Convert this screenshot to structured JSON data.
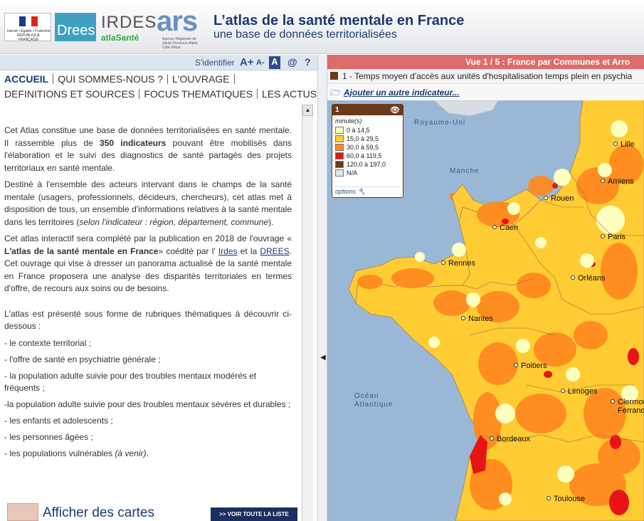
{
  "header": {
    "logos": {
      "republique": "Liberté • Égalité • Fraternité RÉPUBLIQUE FRANÇAISE",
      "drees": "Drees",
      "irdes": "IRDES",
      "atlassante": "atlaSanté",
      "ars": "ars",
      "ars_sub": "Agence Régionale de Santé Provence-Alpes Côte d'Azur"
    },
    "title": "L’atlas de la santé mentale en France",
    "subtitle": "une base de données territorialisées"
  },
  "toolbar": {
    "identify": "S'identifier",
    "font_up": "A+",
    "font_down": "A-",
    "font_default": "A",
    "contact": "@",
    "help": "?"
  },
  "nav": {
    "row1": [
      "ACCUEIL",
      "QUI SOMMES-NOUS ?",
      "L'OUVRAGE"
    ],
    "row2": [
      "DEFINITIONS ET SOURCES",
      "FOCUS THEMATIQUES",
      "LES ACTUS"
    ]
  },
  "content": {
    "p1_a": "Cet Atlas constitue une base de données territorialisées en santé mentale. Il rassemble plus de ",
    "p1_b": "350 indicateurs",
    "p1_c": " pouvant être mobilisés dans l'élaboration et le suivi des diagnostics de santé partagés des projets territoriaux en santé mentale.",
    "p2_a": "Destiné à l'ensemble des acteurs intervant dans le champs de la santé mentale (usagers, professionnels, décideurs, chercheurs), cet atlas met à disposition de tous, un ensemble d'informations relatives à la santé mentale dans les territoires (",
    "p2_b": "selon l'indicateur : région, département, commune",
    "p2_c": ").",
    "p3_a": "Cet atlas interactif sera complété par la publication en 2018 de l'ouvrage « ",
    "p3_b": "L'atlas de la santé mentale en France",
    "p3_c": "» coédité par l' ",
    "p3_link1": "Irdes",
    "p3_d": " et la ",
    "p3_link2": "DREES",
    "p3_e": ". Cet ouvrage qui vise à dresser un panorama actualisé de la santé mentale en France proposera une analyse des disparités territoriales en termes d'offre, de recours aux soins ou de besoins.",
    "list_intro": "L'atlas est présenté sous forme de rubriques thématiques à découvrir ci-dessous :",
    "list": [
      "- le contexte territorial ;",
      "- l'offre de santé en psychiatrie générale ;",
      "- la population adulte suivie pour des troubles mentaux modérés et fréquents ;",
      "-la population adulte suivie pour des troubles mentaux sévères et durables ;",
      "- les enfants et adolescents ;",
      "- les personnes âgées ;"
    ],
    "last_item_a": "- les populations vulnérables ",
    "last_item_b": "(à venir)",
    "last_item_c": "."
  },
  "bottom": {
    "maps_label": "Afficher des cartes",
    "button": ">> VOIR TOUTE LA LISTE"
  },
  "map_panel": {
    "view_title": "Vue 1 / 5 : France par Communes et Arro",
    "indicator": "1 - Temps moyen d'accès aux unités d'hospitalisation temps plein en psychia",
    "add_indicator": "Ajouter un autre indicateur...",
    "legend": {
      "number": "1",
      "unit": "minute(s)",
      "classes": [
        {
          "label": "0 à 14,5",
          "color": "#ffffc0"
        },
        {
          "label": "15,0 à 29,5",
          "color": "#ffcc33"
        },
        {
          "label": "30,0 à 59,5",
          "color": "#ff8a1e"
        },
        {
          "label": "60,0 à 119,5",
          "color": "#e81414"
        },
        {
          "label": "120,0 à 197,0",
          "color": "#6b3a1a"
        },
        {
          "label": "N/A",
          "color": "#dfe4ea"
        }
      ],
      "options": "options"
    },
    "sea_labels": {
      "uk": "Royaume-Uni",
      "manche": "Manche",
      "ocean_1": "Océan",
      "ocean_2": "Atlantique"
    },
    "cities": [
      "Lille",
      "Amiens",
      "Rouen",
      "Caen",
      "Paris",
      "Rennes",
      "Orléans",
      "Nantes",
      "Poitiers",
      "Limoges",
      "Clermon",
      "Ferrand",
      "Bordeaux",
      "Toulouse"
    ],
    "colors": {
      "sea": "#9ab8d6",
      "land_base": "#ffcc33"
    }
  }
}
